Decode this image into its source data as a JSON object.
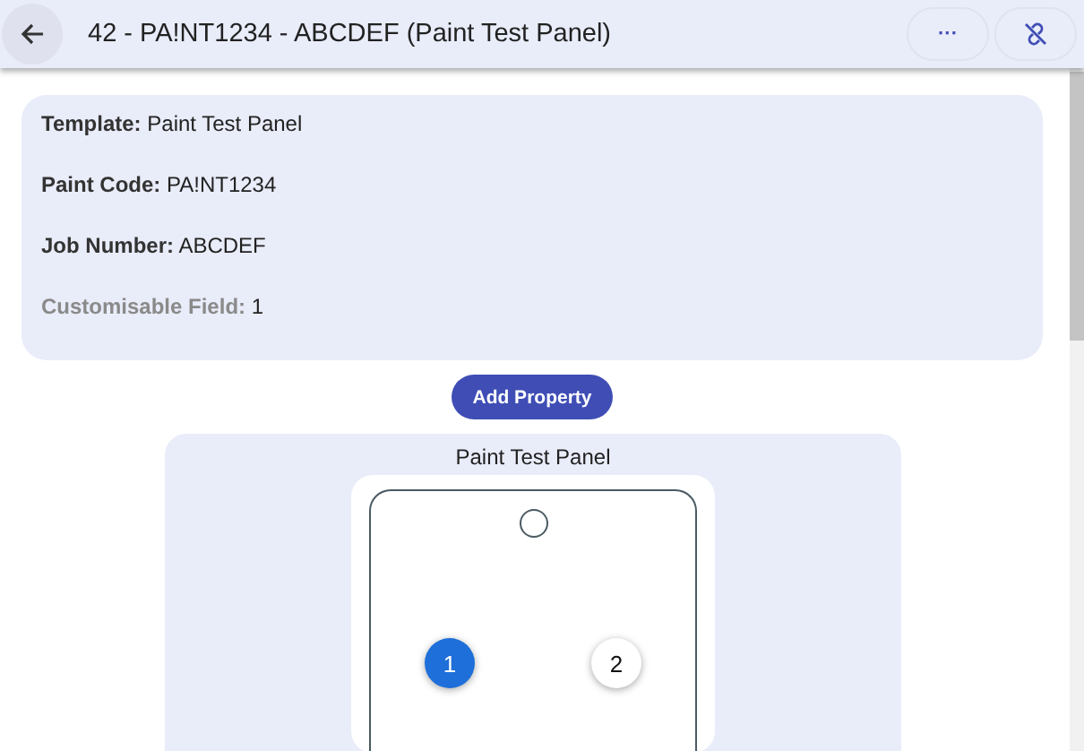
{
  "app_bar": {
    "title": "42 - PA!NT1234 - ABCDEF (Paint Test Panel)",
    "actions": [
      {
        "kind": "more",
        "label": "···"
      },
      {
        "kind": "unlink"
      }
    ]
  },
  "details": [
    {
      "label": "Template:",
      "value": "Paint Test Panel",
      "disabled": false
    },
    {
      "label": "Paint Code:",
      "value": "PA!NT1234",
      "disabled": false
    },
    {
      "label": "Job Number:",
      "value": "ABCDEF",
      "disabled": false
    },
    {
      "label": "Customisable Field:",
      "value": "1",
      "disabled": true
    }
  ],
  "add_button": "Add Property",
  "panel": {
    "title": "Paint Test Panel",
    "markers": [
      {
        "label": "1",
        "selected": true
      },
      {
        "label": "2",
        "selected": false
      }
    ]
  }
}
